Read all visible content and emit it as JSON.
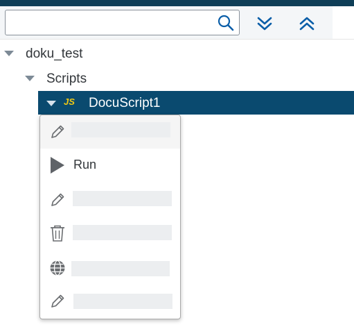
{
  "search": {
    "value": "",
    "placeholder": ""
  },
  "toolbar": {
    "expand_all_icon": "chevrons-down-icon",
    "collapse_all_icon": "chevrons-up-icon",
    "search_icon": "magnifier-icon"
  },
  "tree": {
    "root": {
      "label": "doku_test"
    },
    "folder": {
      "label": "Scripts"
    },
    "selected": {
      "badge": "JS",
      "label": "DocuScript1"
    }
  },
  "context_menu": {
    "items": [
      {
        "icon": "pencil-icon",
        "label": ""
      },
      {
        "icon": "play-icon",
        "label": "Run"
      },
      {
        "icon": "pencil-icon",
        "label": ""
      },
      {
        "icon": "trash-icon",
        "label": ""
      },
      {
        "icon": "globe-icon",
        "label": ""
      },
      {
        "icon": "pencil-icon",
        "label": ""
      }
    ]
  },
  "colors": {
    "header": "#0f3e57",
    "selection": "#0a4a6f",
    "accent": "#0a5ea8",
    "js_badge": "#f0c814"
  }
}
